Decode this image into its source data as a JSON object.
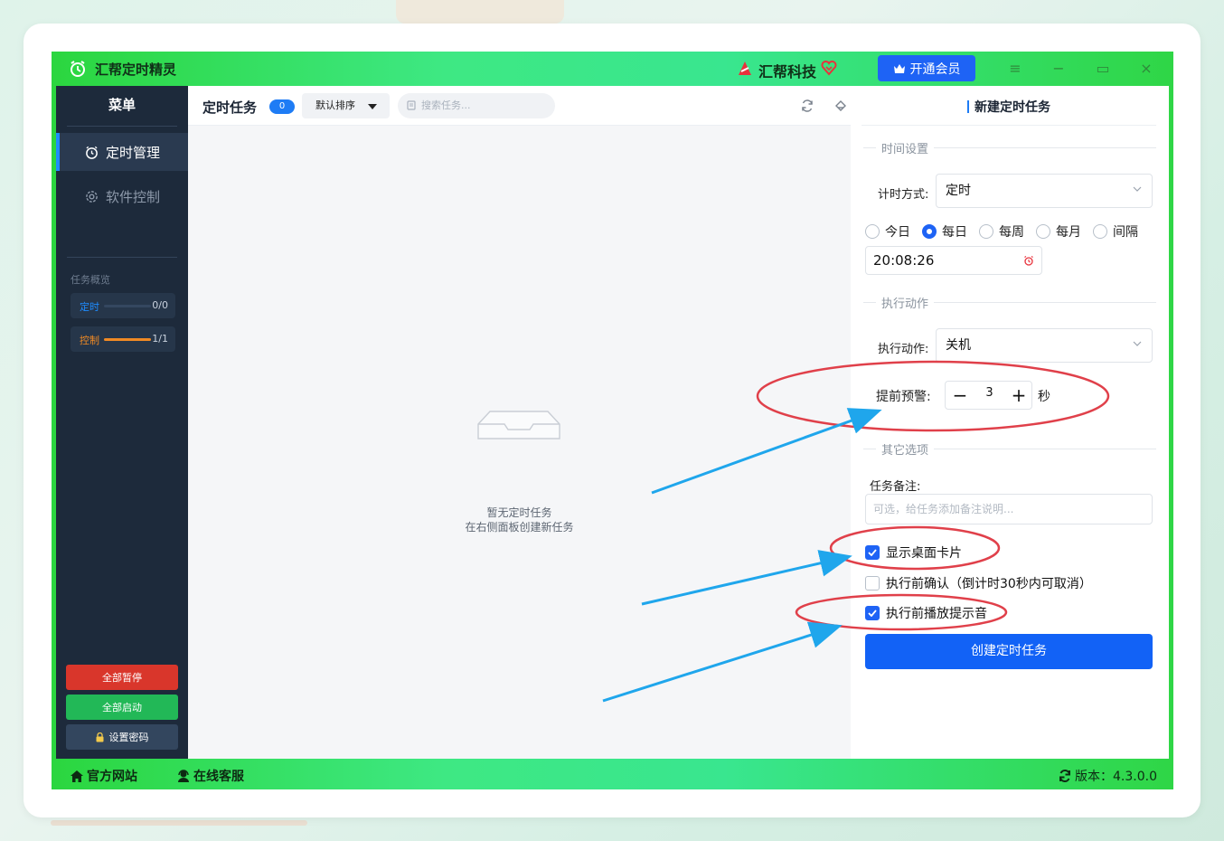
{
  "app": {
    "title": "汇帮定时精灵",
    "brand": "汇帮科技",
    "vip_button": "开通会员"
  },
  "sidebar": {
    "menu_title": "菜单",
    "items": [
      {
        "label": "定时管理",
        "active": true
      },
      {
        "label": "软件控制",
        "active": false
      }
    ],
    "overview": {
      "title": "任务概览",
      "rows": [
        {
          "label": "定时",
          "count": "0/0",
          "color": "#1e8cff",
          "progress": 0
        },
        {
          "label": "控制",
          "count": "1/1",
          "color": "#f08a24",
          "progress": 1
        }
      ]
    },
    "buttons": {
      "pause_all": "全部暂停",
      "start_all": "全部启动",
      "set_password": "设置密码"
    }
  },
  "tasks": {
    "title": "定时任务",
    "count": "0",
    "sort": "默认排序",
    "search_placeholder": "搜索任务...",
    "empty_line1": "暂无定时任务",
    "empty_line2": "在右侧面板创建新任务"
  },
  "form": {
    "title": "新建定时任务",
    "section_time": "时间设置",
    "timing_label": "计时方式:",
    "timing_value": "定时",
    "frequency_options": [
      {
        "label": "今日",
        "selected": false
      },
      {
        "label": "每日",
        "selected": true
      },
      {
        "label": "每周",
        "selected": false
      },
      {
        "label": "每月",
        "selected": false
      },
      {
        "label": "间隔",
        "selected": false
      }
    ],
    "time_value": "20:08:26",
    "section_action": "执行动作",
    "action_label": "执行动作:",
    "action_value": "关机",
    "warning_label": "提前预警:",
    "warning_value": "3",
    "warning_unit": "秒",
    "section_other": "其它选项",
    "note_label": "任务备注:",
    "note_placeholder": "可选，给任务添加备注说明...",
    "checkboxes": [
      {
        "label": "显示桌面卡片",
        "checked": true
      },
      {
        "label": "执行前确认（倒计时30秒内可取消）",
        "checked": false
      },
      {
        "label": "执行前播放提示音",
        "checked": true
      }
    ],
    "create_button": "创建定时任务"
  },
  "statusbar": {
    "website": "官方网站",
    "support": "在线客服",
    "version": "版本：4.3.0.0"
  },
  "colors": {
    "accent_blue": "#1262f6",
    "annotation_red": "#e0404a",
    "annotation_arrow": "#1fa6ec",
    "pause_red": "#d9362b",
    "start_green": "#22b857"
  }
}
